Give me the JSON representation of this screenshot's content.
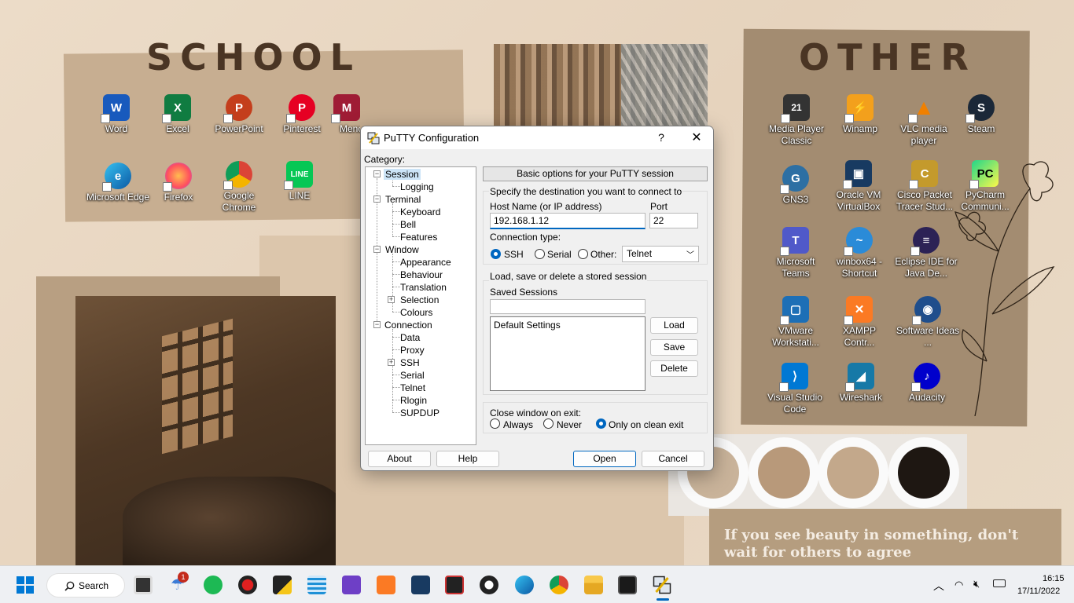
{
  "wallpaper": {
    "school_title": "SCHOOL",
    "other_title": "OTHER",
    "quote": "If you see beauty in something, don't wait for others to agree"
  },
  "desktop_icons": {
    "word": "Word",
    "excel": "Excel",
    "powerpoint": "PowerPoint",
    "pinterest": "Pinterest",
    "mendeley_partial": "Menc",
    "edge": "Microsoft Edge",
    "firefox": "Firefox",
    "chrome": "Google Chrome",
    "line": "LINE",
    "mpc": "Media Player Classic",
    "winamp": "Winamp",
    "vlc": "VLC media player",
    "steam": "Steam",
    "gns3": "GNS3",
    "virtualbox": "Oracle VM VirtualBox",
    "packettracer": "Cisco Packet Tracer Stud...",
    "pycharm": "PyCharm Communi...",
    "teams": "Microsoft Teams",
    "winbox": "winbox64 - Shortcut",
    "eclipse": "Eclipse IDE for Java De...",
    "vmware": "VMware Workstati...",
    "xampp": "XAMPP Contr...",
    "softwareideas": "Software Ideas ...",
    "vscode": "Visual Studio Code",
    "wireshark": "Wireshark",
    "audacity": "Audacity"
  },
  "putty": {
    "title": "PuTTY Configuration",
    "help_glyph": "?",
    "close_glyph": "✕",
    "category_label": "Category:",
    "tree": {
      "session": "Session",
      "logging": "Logging",
      "terminal": "Terminal",
      "keyboard": "Keyboard",
      "bell": "Bell",
      "features": "Features",
      "window": "Window",
      "appearance": "Appearance",
      "behaviour": "Behaviour",
      "translation": "Translation",
      "selection": "Selection",
      "colours": "Colours",
      "connection": "Connection",
      "data": "Data",
      "proxy": "Proxy",
      "ssh": "SSH",
      "serial": "Serial",
      "telnet": "Telnet",
      "rlogin": "Rlogin",
      "supdup": "SUPDUP"
    },
    "banner": "Basic options for your PuTTY session",
    "destination_label": "Specify the destination you want to connect to",
    "host_label": "Host Name (or IP address)",
    "host_value": "192.168.1.12",
    "port_label": "Port",
    "port_value": "22",
    "conn_type_label": "Connection type:",
    "conn_types": {
      "ssh": "SSH",
      "serial": "Serial",
      "other": "Other:"
    },
    "conn_selected": "SSH",
    "other_select_value": "Telnet",
    "sessions_group_label": "Load, save or delete a stored session",
    "saved_sessions_label": "Saved Sessions",
    "saved_sessions_value": "",
    "sessions_list": [
      "Default Settings"
    ],
    "load_button": "Load",
    "save_button": "Save",
    "delete_button": "Delete",
    "close_exit_label": "Close window on exit:",
    "close_options": {
      "always": "Always",
      "never": "Never",
      "clean": "Only on clean exit"
    },
    "close_selected": "Only on clean exit",
    "about_button": "About",
    "help_button": "Help",
    "open_button": "Open",
    "cancel_button": "Cancel"
  },
  "taskbar": {
    "search_label": "Search",
    "notification_count": "1",
    "time": "16:15",
    "date": "17/11/2022",
    "pinned_icons": [
      "start-icon",
      "search-icon",
      "task-view-icon",
      "weather-icon",
      "spotify-icon",
      "record-icon",
      "sticky-notes-icon",
      "notepad-icon",
      "visual-studio-icon",
      "xampp-icon",
      "virtualbox-icon",
      "gns3-icon",
      "media-player-icon",
      "edge-icon",
      "chrome-icon",
      "file-explorer-icon",
      "terminal-icon",
      "putty-icon"
    ]
  },
  "colors": {
    "accent": "#0067c0",
    "selection": "#cce4f7",
    "wallpaper_dark": "#4a3524"
  }
}
